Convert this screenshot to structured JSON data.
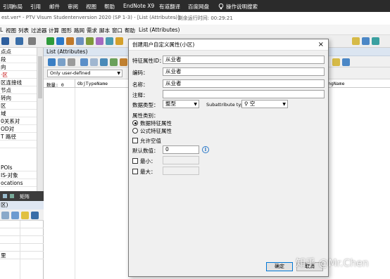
{
  "ribbon": {
    "items": [
      "引用",
      "布局",
      "引用",
      "邮件",
      "审阅",
      "视图",
      "帮助",
      "EndNote X9",
      "有道翻译",
      "百度网盘"
    ],
    "search_label": "操作说明搜索"
  },
  "titlebar": {
    "text": "est.ver* - PTV Visum Studentenversion 2020 (SP 1-3) - [List (Attributes)]",
    "timer": " - 剩余运行时间: 00:29:21"
  },
  "menubar": {
    "items": [
      "L",
      "视图",
      "列表",
      "过滤器",
      "计算",
      "图形",
      "路网",
      "需求",
      "脚本",
      "窗口",
      "帮助",
      "List (Attributes)"
    ]
  },
  "left_tree": {
    "items": [
      "点点",
      "段",
      "向",
      "·区",
      "区连接线",
      "节点",
      "转向",
      "区",
      "域",
      "0关系对",
      "OD对",
      "T 路径",
      "",
      "POIs",
      "IS-对象",
      "ocations"
    ]
  },
  "matrix_tab": {
    "label": "矩阵"
  },
  "lower_left": {
    "header": "区)",
    "rows": [
      "",
      "",
      "",
      "",
      "里"
    ]
  },
  "list": {
    "title": "List (Attributes)",
    "filter": "Only user-defined",
    "count_label": "数量: 0",
    "col_objtypename": "ObjTypeName",
    "col_right": "ngName"
  },
  "dialog": {
    "title": "创建用户自定义属性(小区)",
    "close": "×",
    "attr_id_label": "特征属性ID：",
    "attr_id_value": "从业者",
    "code_label": "编码：",
    "code_value": "从业者",
    "name_label": "名称：",
    "name_value": "从业者",
    "comment_label": "注释：",
    "comment_value": "",
    "datatype_label": "数据类型：",
    "datatype_value": "整型",
    "subtype_label": "Subattribute type:",
    "subtype_value": "空",
    "attr_class_label": "属性类别：",
    "radio_data": "数据特征属性",
    "radio_formula": "公式特征属性",
    "allow_empty": "允许空值",
    "default_label": "默认数值：",
    "default_value": "0",
    "min_label": "最小：",
    "max_label": "最大：",
    "ok": "确定",
    "cancel": "取消"
  },
  "watermark": "知乎 @Mr.Chen"
}
